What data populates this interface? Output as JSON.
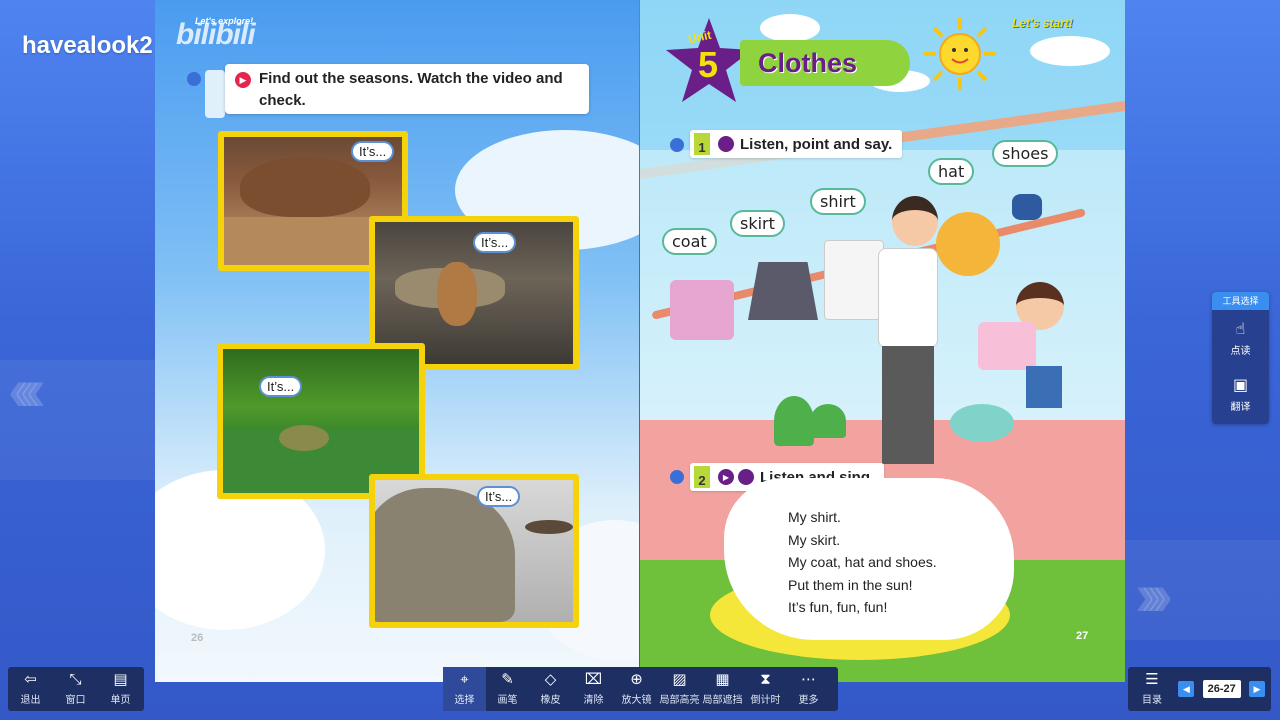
{
  "watermark": "havealook2",
  "bili_logo": "bilibili",
  "left_page": {
    "lets_explore": "Let's explore!",
    "task": "Find out the seasons. Watch the video and check.",
    "bubbles": [
      "It’s...",
      "It’s...",
      "It’s...",
      "It’s..."
    ],
    "page_number": "26"
  },
  "right_page": {
    "unit_label": "Unit",
    "unit_number": "5",
    "title": "Clothes",
    "lets_start": "Let's start!",
    "section1_num": "1",
    "section1_title": "Listen, point and say.",
    "words": {
      "coat": "coat",
      "skirt": "skirt",
      "shirt": "shirt",
      "hat": "hat",
      "shoes": "shoes"
    },
    "section2_num": "2",
    "section2_title": "Listen and sing.",
    "song": [
      "My shirt.",
      "My skirt.",
      "My coat, hat and shoes.",
      "Put them in the sun!",
      "It’s fun, fun, fun!"
    ],
    "page_number": "27"
  },
  "tool_panel": {
    "header": "工具选择",
    "items": [
      "点读",
      "翻译"
    ]
  },
  "left_bar": [
    "退出",
    "窗口",
    "单页"
  ],
  "center_bar": [
    "选择",
    "画笔",
    "橡皮",
    "清除",
    "放大镜",
    "局部高亮",
    "局部遮挡",
    "倒计时",
    "更多"
  ],
  "right_bar": {
    "toc": "目录",
    "page_range": "26-27"
  },
  "colors": {
    "accent": "#3a8ef0",
    "bar": "#1e2f63",
    "frame_yellow": "#f5d20a",
    "unit_purple": "#6a1e88",
    "title_green": "#8fd43e"
  }
}
